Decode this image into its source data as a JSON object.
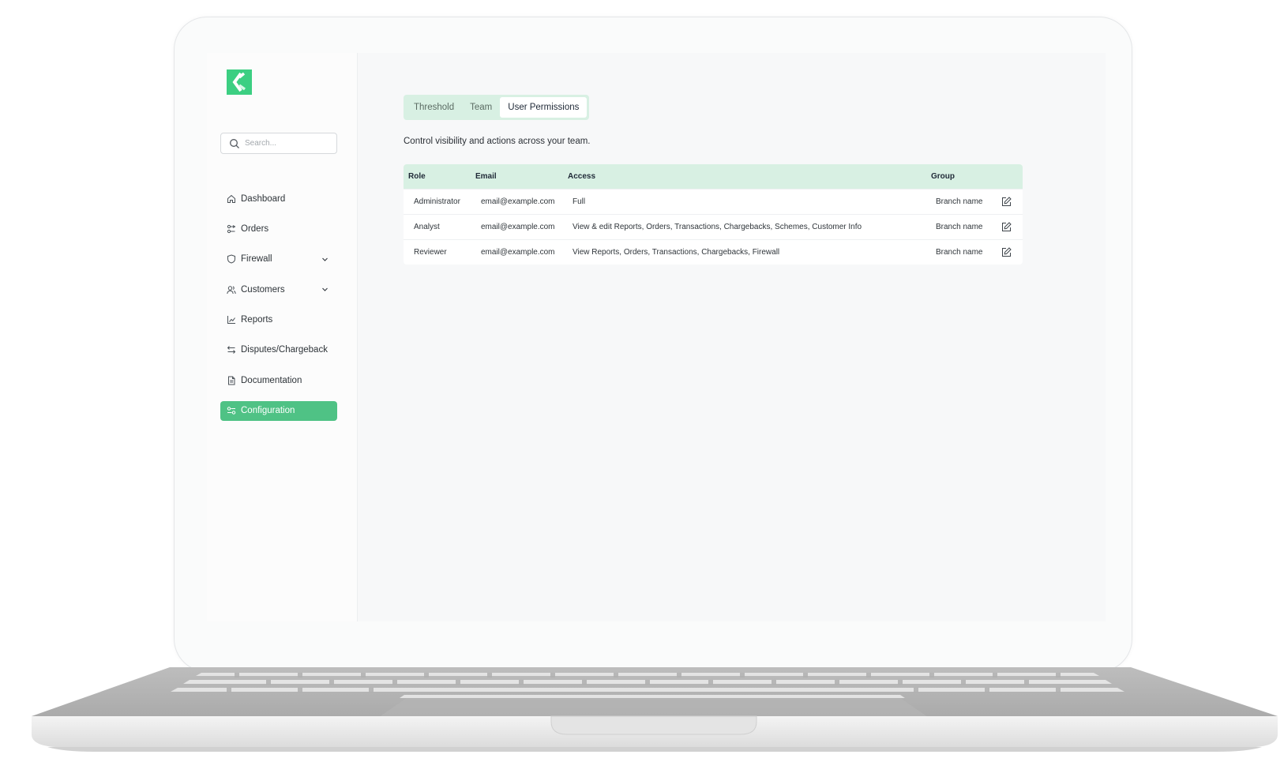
{
  "sidebar": {
    "search_placeholder": "Search...",
    "items": [
      {
        "label": "Dashboard",
        "icon": "home-icon"
      },
      {
        "label": "Orders",
        "icon": "orders-icon"
      },
      {
        "label": "Firewall",
        "icon": "shield-icon",
        "expandable": true
      },
      {
        "label": "Customers",
        "icon": "users-icon",
        "expandable": true
      },
      {
        "label": "Reports",
        "icon": "chart-icon"
      },
      {
        "label": "Disputes/Chargeback",
        "icon": "arrows-icon"
      },
      {
        "label": "Documentation",
        "icon": "document-icon"
      },
      {
        "label": "Configuration",
        "icon": "sliders-icon",
        "active": true
      }
    ]
  },
  "tabs": [
    {
      "label": "Threshold"
    },
    {
      "label": "Team"
    },
    {
      "label": "User Permissions",
      "active": true
    }
  ],
  "subtitle": "Control visibility and actions across your team.",
  "table": {
    "headers": {
      "role": "Role",
      "email": "Email",
      "access": "Access",
      "group": "Group"
    },
    "rows": [
      {
        "role": "Administrator",
        "email": "email@example.com",
        "access": "Full",
        "group": "Branch name"
      },
      {
        "role": "Analyst",
        "email": "email@example.com",
        "access": "View & edit Reports, Orders, Transactions, Chargebacks, Schemes, Customer Info",
        "group": "Branch name"
      },
      {
        "role": "Reviewer",
        "email": "email@example.com",
        "access": "View Reports, Orders, Transactions, Chargebacks, Firewall",
        "group": "Branch name"
      }
    ]
  },
  "colors": {
    "accent": "#3ccf82",
    "active_nav": "#4fc285",
    "header_bg": "#d8f0e3"
  }
}
